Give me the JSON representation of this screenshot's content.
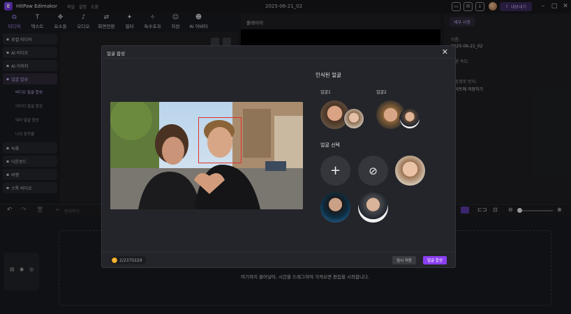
{
  "app": {
    "name": "HitPaw Edimakor",
    "menu": [
      "파일",
      "설정",
      "도움"
    ],
    "project_title": "2025-06-21_02",
    "export_label": "내보내기"
  },
  "toolbar": [
    {
      "icon": "media-icon",
      "glyph": "⧉",
      "label": "미디어",
      "active": true
    },
    {
      "icon": "text-icon",
      "glyph": "T",
      "label": "텍스트"
    },
    {
      "icon": "elements-icon",
      "glyph": "✥",
      "label": "요소들"
    },
    {
      "icon": "audio-icon",
      "glyph": "♪",
      "label": "오디오"
    },
    {
      "icon": "transition-icon",
      "glyph": "⇄",
      "label": "화면전환"
    },
    {
      "icon": "filter-icon",
      "glyph": "✦",
      "label": "필터"
    },
    {
      "icon": "effects-icon",
      "glyph": "✧",
      "label": "특수효과"
    },
    {
      "icon": "sticker-icon",
      "glyph": "☺",
      "label": "차원"
    },
    {
      "icon": "ai-avatar-icon",
      "glyph": "☻",
      "label": "AI 아바타"
    }
  ],
  "sidebar": {
    "items": [
      {
        "label": "로컬 미디어",
        "icon": "folder-icon"
      },
      {
        "label": "AI 비디오",
        "icon": "ai-video-icon"
      },
      {
        "label": "AI 이미지",
        "icon": "ai-image-icon"
      },
      {
        "label": "얼굴 합성",
        "icon": "face-swap-icon",
        "active": true
      }
    ],
    "subitems": [
      {
        "label": "비디오 얼굴 합성",
        "active": true
      },
      {
        "label": "이미지 얼굴 합성"
      },
      {
        "label": "여러 얼굴 합성"
      },
      {
        "label": "나의 창작물"
      }
    ],
    "items2": [
      {
        "label": "녹화",
        "icon": "record-icon"
      },
      {
        "label": "다운로드",
        "icon": "download-icon"
      },
      {
        "label": "비행",
        "icon": "arrow-icon"
      },
      {
        "label": "스톡 비디오",
        "icon": "stock-video-icon"
      }
    ]
  },
  "player": {
    "title": "플레이어"
  },
  "properties": {
    "tab": "세부 사항",
    "name_label": "이름:",
    "name_value": "2025-06-21_02",
    "speed_label": "재생 속도:",
    "save_path_label": "저장경로 방식:",
    "save_path_value": "파이트에 저장하기"
  },
  "timeline": {
    "undo_label": "분리하기",
    "drop_hint": "여기까지 끌어넣어, 시간을 드래그하여 가져오면 편집을 시작합니다."
  },
  "dialog": {
    "title": "얼굴 합성",
    "recognized_title": "인식된 얼굴",
    "face1_label": "얼굴1",
    "face2_label": "얼굴2",
    "select_title": "얼굴 선택",
    "coins": "2/2370229",
    "save_btn": "임시 저장",
    "generate_btn": "얼굴 합성"
  },
  "colors": {
    "accent": "#8b3ff0",
    "face_box": "#e0302a",
    "background": "#1a1b1f"
  }
}
